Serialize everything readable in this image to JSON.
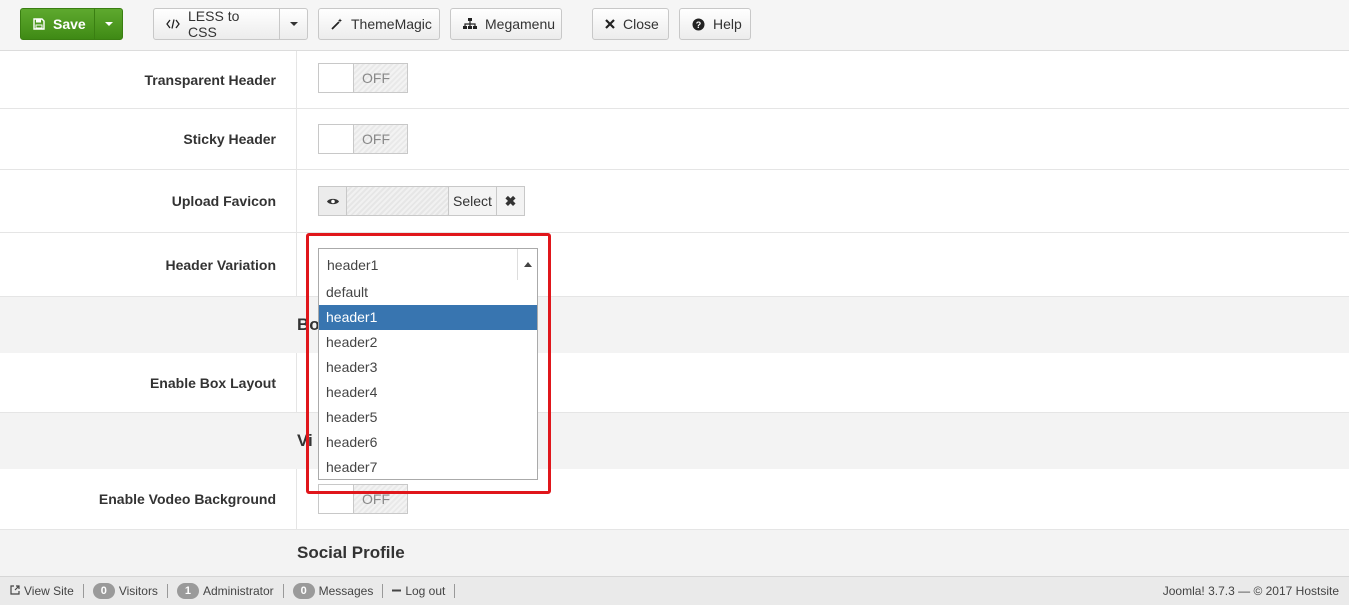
{
  "toolbar": {
    "save_label": "Save",
    "less_label": "LESS to CSS",
    "thememagic_label": "ThemeMagic",
    "megamenu_label": "Megamenu",
    "close_label": "Close",
    "help_label": "Help",
    "save_color": "#4a9a1f"
  },
  "fields": {
    "transparent_header": {
      "label": "Transparent Header",
      "state": "OFF"
    },
    "sticky_header": {
      "label": "Sticky Header",
      "state": "OFF"
    },
    "upload_favicon": {
      "label": "Upload Favicon",
      "select_label": "Select",
      "clear_symbol": "✖"
    },
    "header_variation": {
      "label": "Header Variation",
      "selected": "header1",
      "options": [
        "default",
        "header1",
        "header2",
        "header3",
        "header4",
        "header5",
        "header6",
        "header7"
      ]
    },
    "enable_box_layout": {
      "label": "Enable Box Layout"
    },
    "enable_video_background": {
      "label": "Enable Vodeo Background",
      "state": "OFF"
    }
  },
  "sections": {
    "box_partial": "Bo",
    "video_partial": "Vi",
    "social_profile": "Social Profile"
  },
  "statusbar": {
    "view_site": "View Site",
    "visitors_count": "0",
    "visitors_label": "Visitors",
    "admin_count": "1",
    "admin_label": "Administrator",
    "messages_count": "0",
    "messages_label": "Messages",
    "logout_label": "Log out",
    "version_text": "Joomla! 3.7.3  —  © 2017 Hostsite"
  },
  "colors": {
    "highlight": "#e0161b",
    "selected_option": "#3875b0"
  }
}
